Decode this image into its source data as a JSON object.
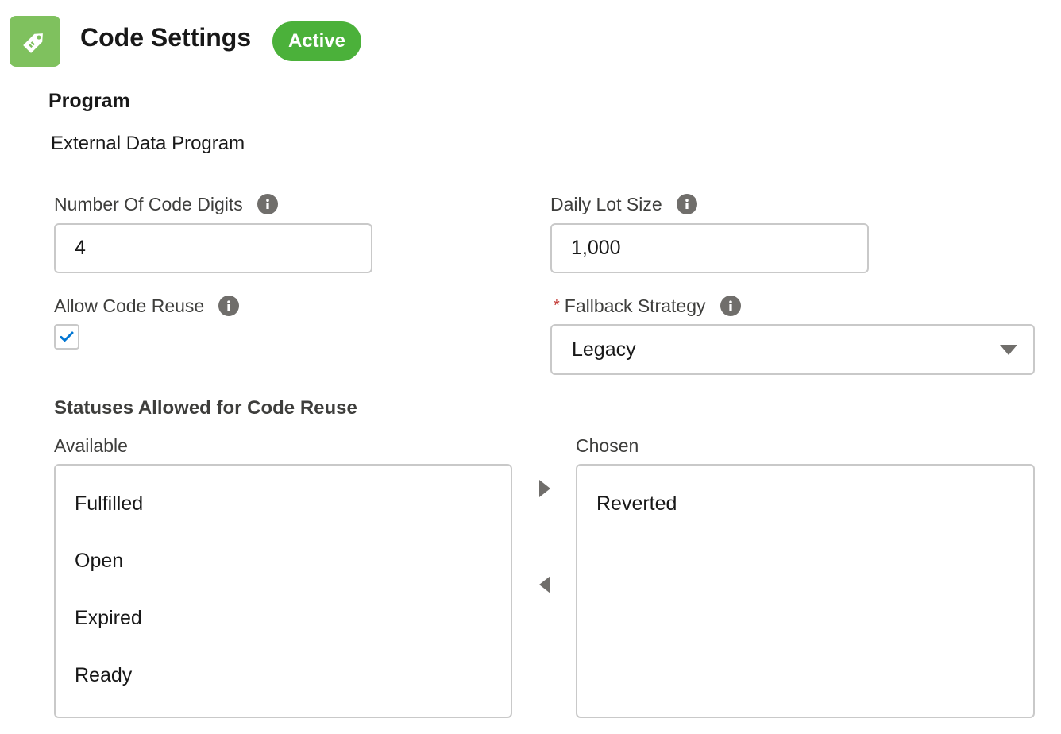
{
  "header": {
    "title": "Code Settings",
    "status_badge": "Active",
    "icon": "tag-icon",
    "icon_color": "#7fc15e",
    "badge_color": "#4bb13a"
  },
  "program": {
    "label": "Program",
    "value": "External Data Program"
  },
  "fields": {
    "code_digits": {
      "label": "Number Of Code Digits",
      "value": "4"
    },
    "daily_lot_size": {
      "label": "Daily Lot Size",
      "value": "1,000"
    },
    "allow_code_reuse": {
      "label": "Allow Code Reuse",
      "checked": true
    },
    "fallback_strategy": {
      "required_marker": "*",
      "label": "Fallback Strategy",
      "value": "Legacy"
    }
  },
  "statuses": {
    "heading": "Statuses Allowed for Code Reuse",
    "available_label": "Available",
    "chosen_label": "Chosen",
    "available": [
      "Fulfilled",
      "Open",
      "Expired",
      "Ready"
    ],
    "chosen": [
      "Reverted"
    ]
  }
}
